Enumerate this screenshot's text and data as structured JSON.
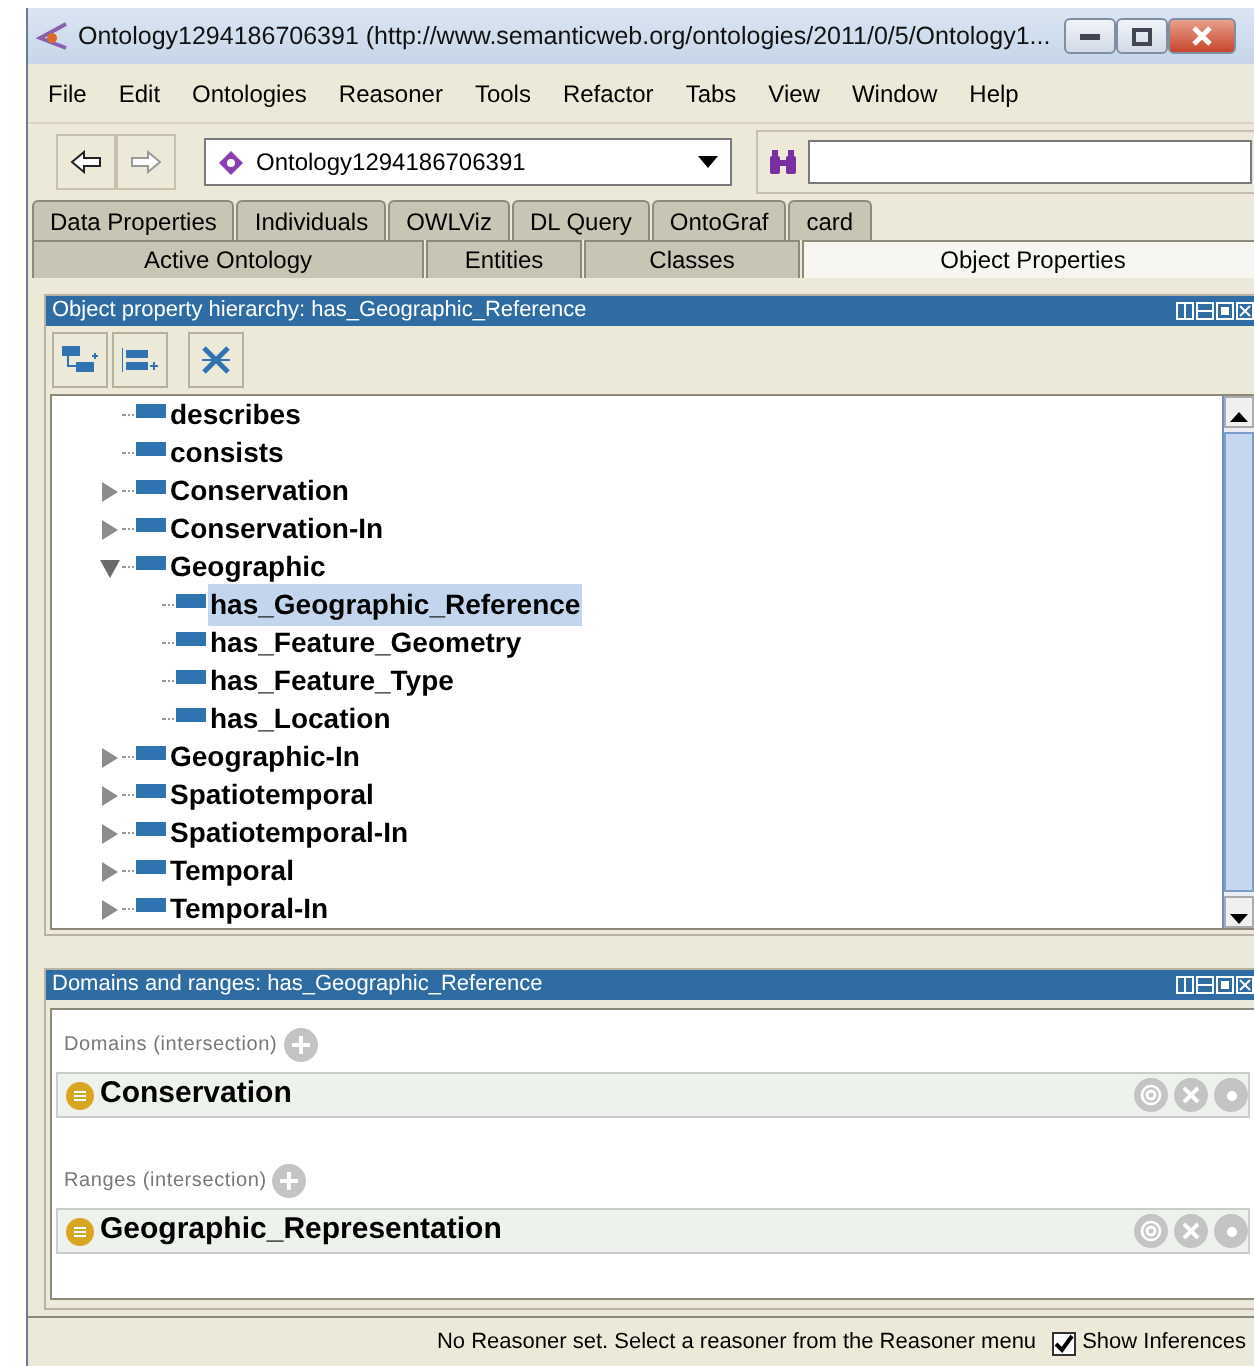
{
  "window": {
    "title": "Ontology1294186706391 (http://www.semanticweb.org/ontologies/2011/0/5/Ontology1..."
  },
  "menu": [
    "File",
    "Edit",
    "Ontologies",
    "Reasoner",
    "Tools",
    "Refactor",
    "Tabs",
    "View",
    "Window",
    "Help"
  ],
  "toolbar": {
    "ontology": "Ontology1294186706391"
  },
  "tabs_top": [
    {
      "label": "Data Properties",
      "selected": false
    },
    {
      "label": "Individuals",
      "selected": false
    },
    {
      "label": "OWLViz",
      "selected": false
    },
    {
      "label": "DL Query",
      "selected": false
    },
    {
      "label": "OntoGraf",
      "selected": false
    },
    {
      "label": "card",
      "selected": false
    }
  ],
  "tabs_bottom": [
    {
      "label": "Active Ontology",
      "selected": false
    },
    {
      "label": "Entities",
      "selected": false
    },
    {
      "label": "Classes",
      "selected": false
    },
    {
      "label": "Object Properties",
      "selected": true
    }
  ],
  "hierarchy": {
    "title": "Object property hierarchy: has_Geographic_Reference",
    "items": [
      {
        "label": "describes",
        "kind": "leaf",
        "selected": false
      },
      {
        "label": "consists",
        "kind": "leaf",
        "selected": false
      },
      {
        "label": "Conservation",
        "kind": "node",
        "expanded": false,
        "selected": false
      },
      {
        "label": "Conservation-In",
        "kind": "node",
        "expanded": false,
        "selected": false
      },
      {
        "label": "Geographic",
        "kind": "node",
        "expanded": true,
        "selected": false,
        "children": [
          {
            "label": "has_Geographic_Reference",
            "kind": "leaf",
            "selected": true
          },
          {
            "label": "has_Feature_Geometry",
            "kind": "leaf",
            "selected": false
          },
          {
            "label": "has_Feature_Type",
            "kind": "leaf",
            "selected": false
          },
          {
            "label": "has_Location",
            "kind": "leaf",
            "selected": false
          }
        ]
      },
      {
        "label": "Geographic-In",
        "kind": "node",
        "expanded": false,
        "selected": false
      },
      {
        "label": "Spatiotemporal",
        "kind": "node",
        "expanded": false,
        "selected": false
      },
      {
        "label": "Spatiotemporal-In",
        "kind": "node",
        "expanded": false,
        "selected": false
      },
      {
        "label": "Temporal",
        "kind": "node",
        "expanded": false,
        "selected": false
      },
      {
        "label": "Temporal-In",
        "kind": "node",
        "expanded": false,
        "selected": false
      }
    ]
  },
  "domains_ranges": {
    "title": "Domains and ranges: has_Geographic_Reference",
    "sections": [
      {
        "label": "Domains (intersection)",
        "entries": [
          "Conservation"
        ]
      },
      {
        "label": "Ranges (intersection)",
        "entries": [
          "Geographic_Representation"
        ]
      }
    ]
  },
  "status_bar": {
    "message": "No Reasoner set. Select a reasoner from the Reasoner menu",
    "show_inferences": {
      "label": "Show Inferences",
      "checked": true
    }
  }
}
